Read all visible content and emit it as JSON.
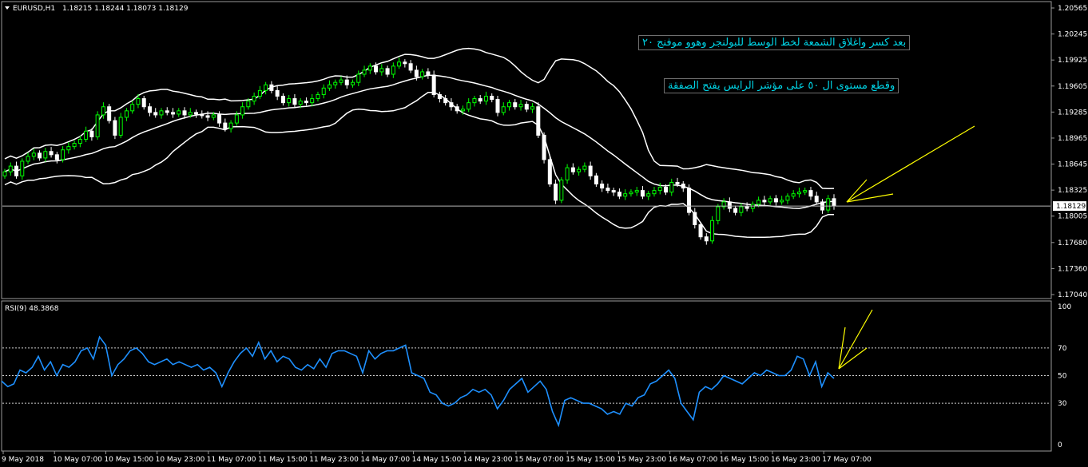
{
  "header": {
    "symbol": "EURUSD,H1",
    "ohlc": "1.18215 1.18244 1.18073 1.18129"
  },
  "rsi_header": "RSI(9) 48.3868",
  "notes": [
    "بعد كسر واغلاق الشمعة لخط الوسط للبولنجر وهوو موفنج ٢٠",
    "وقطع مستوى ال ٥٠ على مؤشر الرايس    يفتح الصفقة"
  ],
  "colors": {
    "background": "#000000",
    "candle_bull": "#00ff00",
    "candle_bear": "#ffffff",
    "bands": "#ffffff",
    "rsi_line": "#1e90ff",
    "arrows": "#ffff00",
    "note_text": "#00d4e6"
  },
  "chart_data": [
    {
      "type": "candlestick",
      "symbol": "EURUSD,H1",
      "y_ticks": [
        "1.20565",
        "1.20245",
        "1.19925",
        "1.19605",
        "1.19285",
        "1.18965",
        "1.18645",
        "1.18325",
        "1.18005",
        "1.17680",
        "1.17360",
        "1.17040"
      ],
      "ylim": [
        1.1704,
        1.20565
      ],
      "current_price": "1.18129",
      "overlays": [
        "Bollinger Bands (upper, middle, lower)"
      ],
      "x_ticks": [
        "9 May 2018",
        "10 May 07:00",
        "10 May 15:00",
        "10 May 23:00",
        "11 May 07:00",
        "11 May 15:00",
        "11 May 23:00",
        "14 May 07:00",
        "14 May 15:00",
        "14 May 23:00",
        "15 May 07:00",
        "15 May 15:00",
        "15 May 23:00",
        "16 May 07:00",
        "16 May 15:00",
        "16 May 23:00",
        "17 May 07:00"
      ],
      "close": [
        1.1855,
        1.1862,
        1.185,
        1.1868,
        1.1874,
        1.1878,
        1.1872,
        1.188,
        1.1876,
        1.187,
        1.1882,
        1.1886,
        1.189,
        1.1895,
        1.1905,
        1.1898,
        1.1925,
        1.1935,
        1.1918,
        1.19,
        1.1922,
        1.193,
        1.1938,
        1.1945,
        1.1935,
        1.1928,
        1.1925,
        1.193,
        1.1928,
        1.1926,
        1.193,
        1.1925,
        1.1928,
        1.1926,
        1.1924,
        1.1922,
        1.1925,
        1.1915,
        1.1908,
        1.1915,
        1.1925,
        1.1935,
        1.1942,
        1.1948,
        1.1955,
        1.1962,
        1.1955,
        1.1948,
        1.194,
        1.1945,
        1.1938,
        1.1942,
        1.194,
        1.1945,
        1.195,
        1.1958,
        1.1962,
        1.1965,
        1.1968,
        1.1962,
        1.1965,
        1.1975,
        1.198,
        1.1985,
        1.1978,
        1.1982,
        1.1975,
        1.1985,
        1.199,
        1.1988,
        1.198,
        1.1972,
        1.1978,
        1.1974,
        1.195,
        1.1945,
        1.194,
        1.1935,
        1.193,
        1.1932,
        1.194,
        1.1945,
        1.1942,
        1.1948,
        1.1944,
        1.1928,
        1.1935,
        1.194,
        1.1935,
        1.1938,
        1.1932,
        1.1935,
        1.19,
        1.187,
        1.184,
        1.182,
        1.1845,
        1.186,
        1.1855,
        1.1858,
        1.1862,
        1.185,
        1.184,
        1.1835,
        1.1832,
        1.183,
        1.1825,
        1.1828,
        1.183,
        1.1832,
        1.1825,
        1.1828,
        1.1832,
        1.1836,
        1.183,
        1.1842,
        1.184,
        1.1835,
        1.1805,
        1.179,
        1.1775,
        1.177,
        1.1795,
        1.1812,
        1.1818,
        1.181,
        1.1805,
        1.1812,
        1.181,
        1.1815,
        1.182,
        1.1818,
        1.1822,
        1.1818,
        1.182,
        1.1825,
        1.1828,
        1.183,
        1.1832,
        1.1825,
        1.1818,
        1.1808,
        1.1822,
        1.1813
      ]
    },
    {
      "type": "line",
      "title": "RSI(9) 48.3868",
      "series": [
        {
          "name": "RSI(9)",
          "values": [
            46,
            42,
            44,
            54,
            52,
            56,
            64,
            54,
            60,
            50,
            58,
            56,
            60,
            68,
            70,
            62,
            78,
            72,
            50,
            58,
            62,
            68,
            70,
            66,
            60,
            58,
            60,
            62,
            58,
            60,
            58,
            56,
            58,
            54,
            56,
            52,
            42,
            52,
            60,
            66,
            70,
            64,
            74,
            62,
            68,
            60,
            64,
            62,
            56,
            54,
            58,
            55,
            62,
            56,
            66,
            68,
            68,
            66,
            64,
            52,
            68,
            62,
            66,
            68,
            68,
            70,
            72,
            52,
            50,
            48,
            38,
            36,
            30,
            28,
            30,
            34,
            36,
            40,
            38,
            40,
            36,
            26,
            32,
            40,
            44,
            48,
            38,
            42,
            46,
            40,
            24,
            14,
            32,
            34,
            32,
            30,
            30,
            28,
            26,
            22,
            24,
            22,
            30,
            28,
            34,
            36,
            44,
            46,
            50,
            54,
            48,
            30,
            24,
            18,
            38,
            42,
            40,
            44,
            50,
            48,
            46,
            44,
            48,
            52,
            50,
            54,
            52,
            50,
            50,
            54,
            64,
            62,
            50,
            60,
            42,
            52,
            48
          ]
        }
      ],
      "y_ticks": [
        "100",
        "70",
        "50",
        "30",
        "0"
      ],
      "levels": [
        70,
        50,
        30
      ],
      "ylim": [
        0,
        100
      ]
    }
  ]
}
